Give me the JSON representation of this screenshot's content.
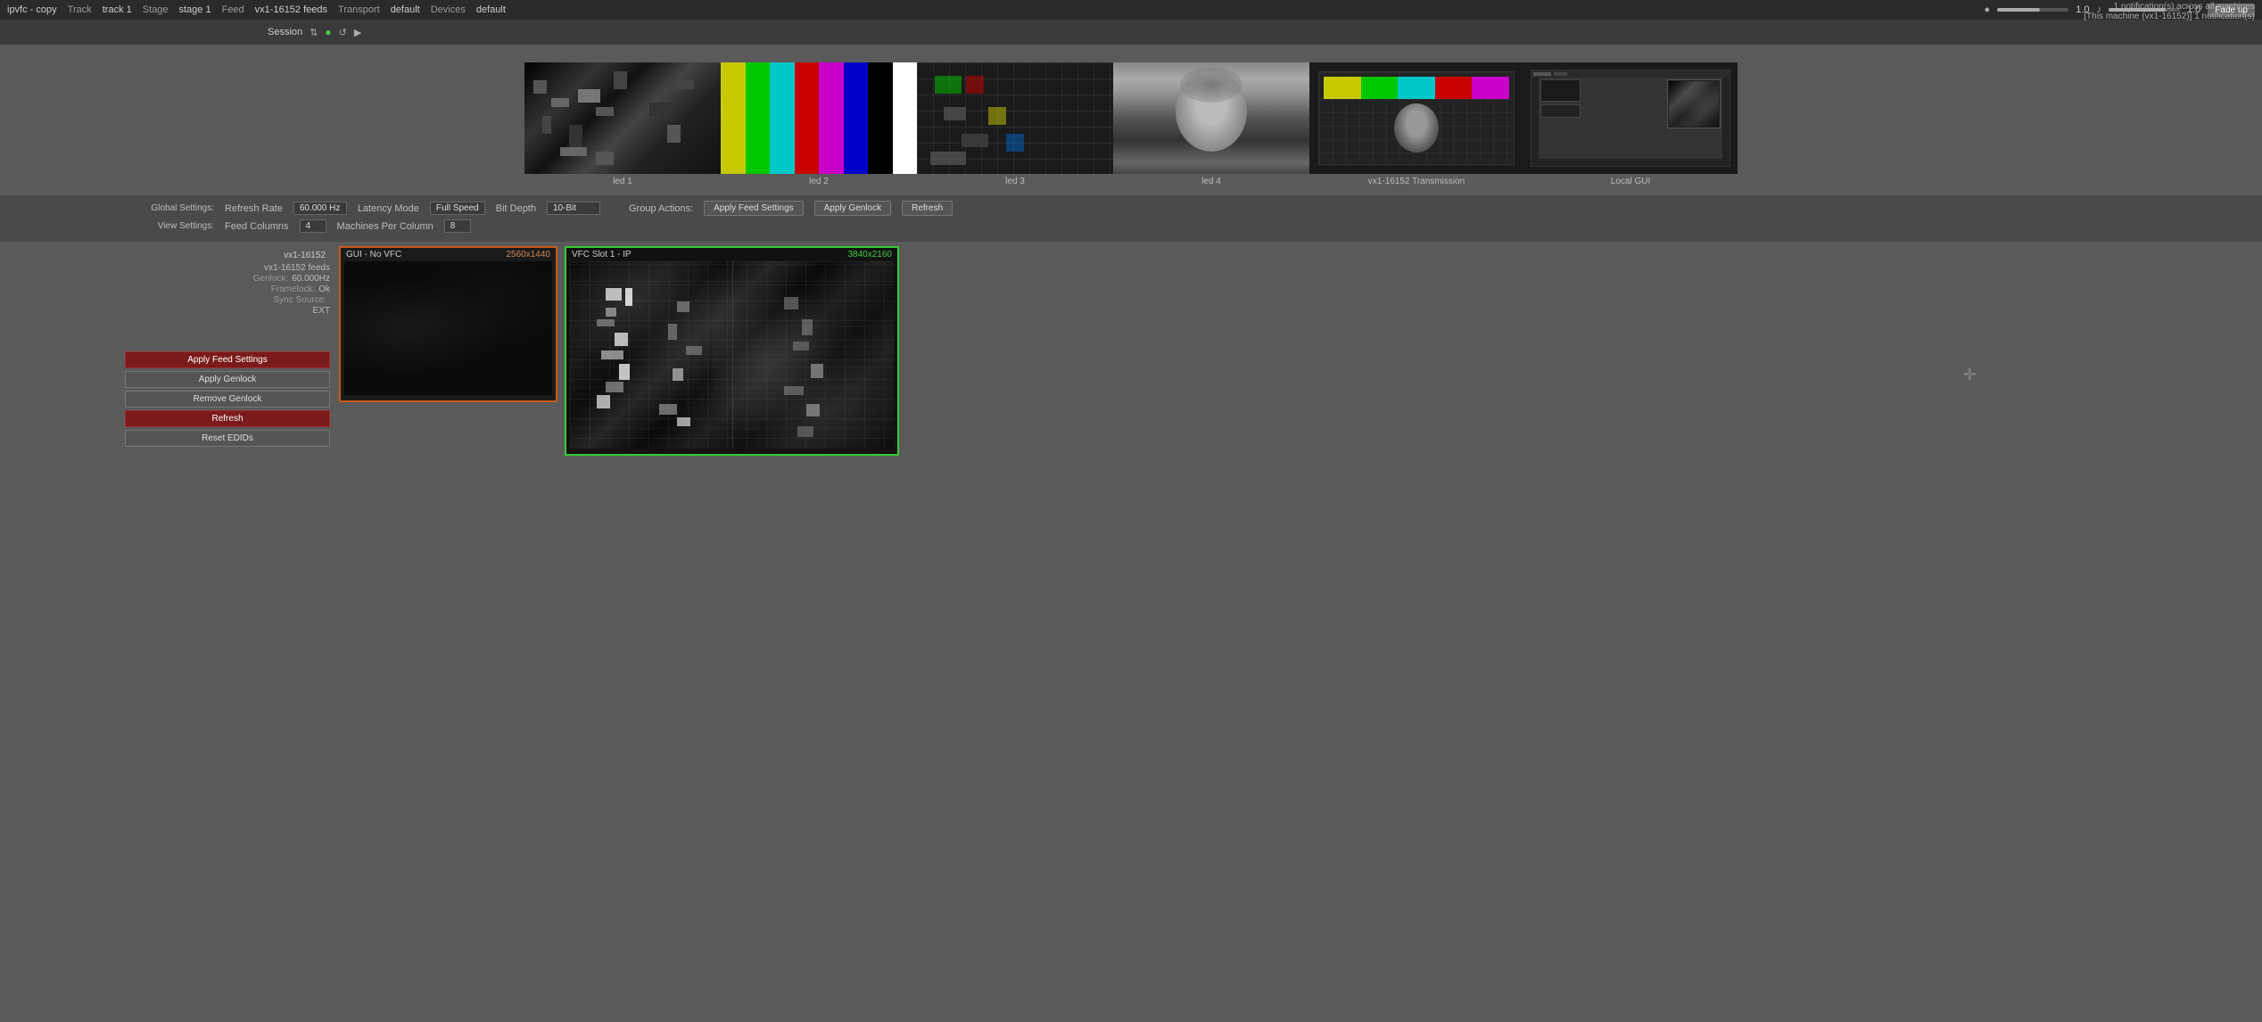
{
  "topbar": {
    "app_name": "ipvfc - copy",
    "track_label": "Track",
    "track_value": "track 1",
    "stage_label": "Stage",
    "stage_value": "stage 1",
    "feed_label": "Feed",
    "feed_value": "vx1-16152 feeds",
    "transport_label": "Transport",
    "transport_value": "default",
    "devices_label": "Devices",
    "devices_value": "default",
    "volume_value": "1.0",
    "master_value": "1.0",
    "fade_btn": "Fade up",
    "notification_line1": "1 notification(s) across all machines",
    "notification_line2": "[This machine (vx1-16152)] 1 notification(s)"
  },
  "session": {
    "label": "Session"
  },
  "thumbnails": [
    {
      "id": "led1",
      "label": "led 1",
      "type": "led1"
    },
    {
      "id": "led2",
      "label": "led 2",
      "type": "colorbars"
    },
    {
      "id": "led3",
      "label": "led 3",
      "type": "led3"
    },
    {
      "id": "led4",
      "label": "led 4",
      "type": "led4"
    },
    {
      "id": "vx1trans",
      "label": "vx1-16152 Transmission",
      "type": "vx1"
    },
    {
      "id": "localgui",
      "label": "Local GUI",
      "type": "local"
    }
  ],
  "global_settings": {
    "label": "Global Settings:",
    "refresh_rate_label": "Refresh Rate",
    "refresh_rate_value": "60.000 Hz",
    "latency_mode_label": "Latency Mode",
    "latency_mode_value": "Full Speed",
    "bit_depth_label": "Bit Depth",
    "bit_depth_value": "10-Bit",
    "group_actions_label": "Group Actions:",
    "apply_feed_btn": "Apply Feed Settings",
    "apply_genlock_btn": "Apply Genlock",
    "refresh_btn": "Refresh"
  },
  "view_settings": {
    "label": "View Settings:",
    "feed_columns_label": "Feed Columns",
    "feed_columns_value": "4",
    "machines_per_column_label": "Machines Per Column",
    "machines_per_column_value": "8"
  },
  "machine": {
    "name": "vx1-16152",
    "feeds_label": "vx1-16152 feeds",
    "genlock_label": "Genlock:",
    "genlock_value": "60.000Hz",
    "framelock_label": "Framelock:",
    "framelock_value": "Ok",
    "sync_source_label": "Sync Source:",
    "sync_source_value": "",
    "ext_label": "EXT",
    "apply_feed_btn": "Apply Feed Settings",
    "apply_genlock_btn": "Apply Genlock",
    "remove_genlock_btn": "Remove Genlock",
    "refresh_btn": "Refresh",
    "reset_edids_btn": "Reset EDIDs"
  },
  "feed_boxes": {
    "no_vfc": {
      "title": "GUI - No VFC",
      "resolution": "2560x1440"
    },
    "vfc_slot1": {
      "title": "VFC Slot 1 - IP",
      "resolution": "3840x2160"
    }
  },
  "colorbars": [
    "#c8c800",
    "#00c800",
    "#00c8c8",
    "#c80000",
    "#c800c8",
    "#0000c8",
    "#000000",
    "#ffffff"
  ]
}
